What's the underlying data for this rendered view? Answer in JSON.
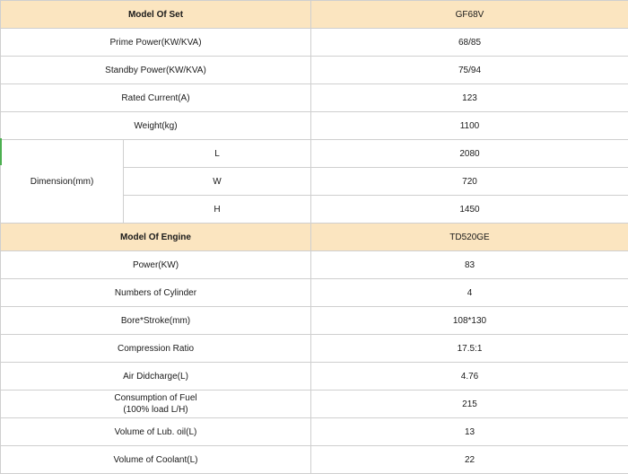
{
  "set_header": {
    "label": "Model Of Set",
    "value": "GF68V"
  },
  "set_rows": [
    {
      "label": "Prime Power(KW/KVA)",
      "value": "68/85"
    },
    {
      "label": "Standby Power(KW/KVA)",
      "value": "75/94"
    },
    {
      "label": "Rated Current(A)",
      "value": "123"
    },
    {
      "label": "Weight(kg)",
      "value": "1100"
    }
  ],
  "dimension": {
    "label": "Dimension(mm)",
    "rows": [
      {
        "axis": "L",
        "value": "2080"
      },
      {
        "axis": "W",
        "value": "720"
      },
      {
        "axis": "H",
        "value": "1450"
      }
    ]
  },
  "engine_header": {
    "label": "Model Of Engine",
    "value": "TD520GE"
  },
  "engine_rows": [
    {
      "label": "Power(KW)",
      "value": "83"
    },
    {
      "label": "Numbers of Cylinder",
      "value": "4"
    },
    {
      "label": "Bore*Stroke(mm)",
      "value": "108*130"
    },
    {
      "label": "Compression Ratio",
      "value": "17.5:1"
    },
    {
      "label": "Air Didcharge(L)",
      "value": "4.76"
    },
    {
      "label": "Consumption of Fuel",
      "label2": "(100% load L/H)",
      "value": "215"
    },
    {
      "label": "Volume of Lub. oil(L)",
      "value": "13"
    },
    {
      "label": "Volume of Coolant(L)",
      "value": "22"
    }
  ]
}
